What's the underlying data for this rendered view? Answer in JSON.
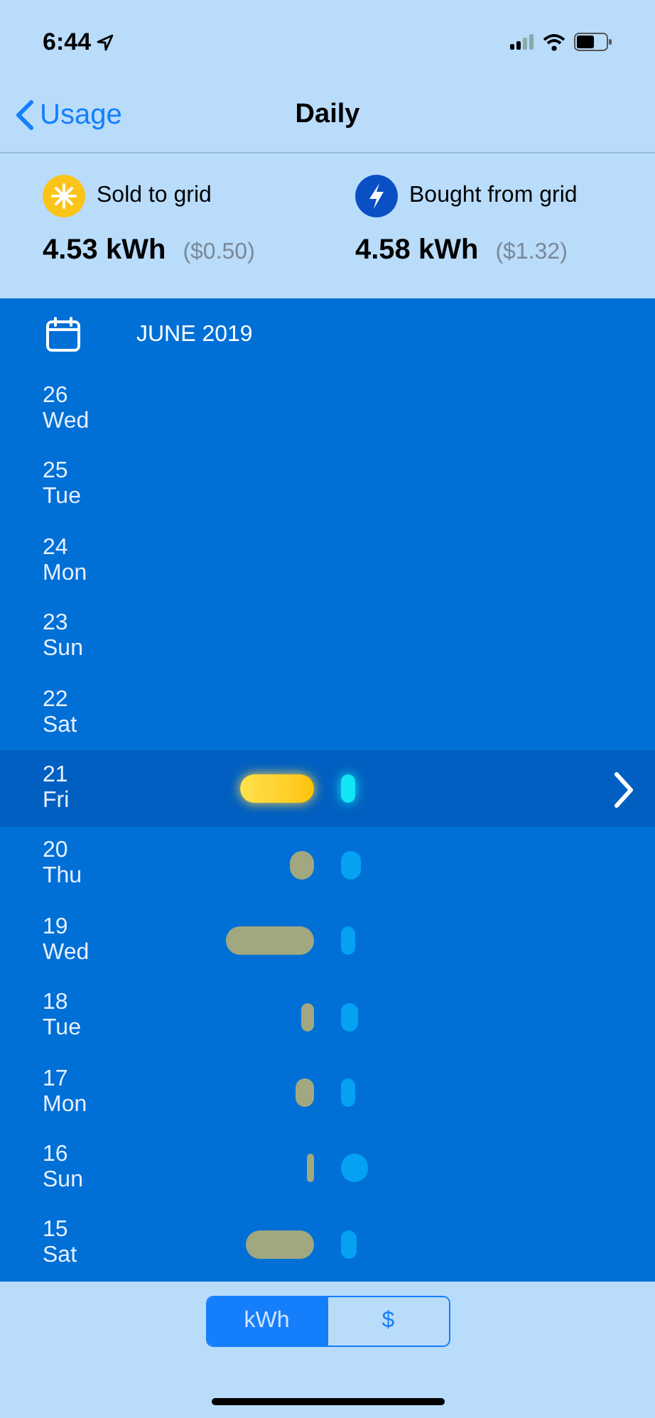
{
  "status_bar": {
    "time": "6:44"
  },
  "nav": {
    "back": "Usage",
    "title": "Daily"
  },
  "summary": [
    {
      "kind": "sold",
      "label": "Sold to grid",
      "amount": "4.53 kWh",
      "cost": "($0.50)"
    },
    {
      "kind": "bought",
      "label": "Bought from grid",
      "amount": "4.58 kWh",
      "cost": "($1.32)"
    }
  ],
  "month": "JUNE 2019",
  "days": [
    {
      "date": "26",
      "weekday": "Wed",
      "selected": false
    },
    {
      "date": "25",
      "weekday": "Tue",
      "selected": false
    },
    {
      "date": "24",
      "weekday": "Mon",
      "selected": false
    },
    {
      "date": "23",
      "weekday": "Sun",
      "selected": false
    },
    {
      "date": "22",
      "weekday": "Sat",
      "selected": false
    },
    {
      "date": "21",
      "weekday": "Fri",
      "selected": true
    },
    {
      "date": "20",
      "weekday": "Thu",
      "selected": false
    },
    {
      "date": "19",
      "weekday": "Wed",
      "selected": false
    },
    {
      "date": "18",
      "weekday": "Tue",
      "selected": false
    },
    {
      "date": "17",
      "weekday": "Mon",
      "selected": false
    },
    {
      "date": "16",
      "weekday": "Sun",
      "selected": false
    },
    {
      "date": "15",
      "weekday": "Sat",
      "selected": false
    }
  ],
  "units": [
    {
      "label": "kWh",
      "selected": true
    },
    {
      "label": "$",
      "selected": false
    }
  ]
}
